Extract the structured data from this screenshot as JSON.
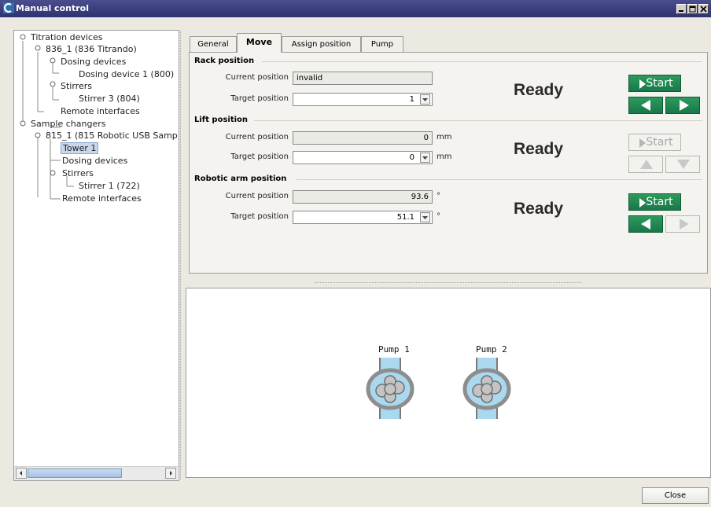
{
  "window": {
    "title": "Manual control",
    "icon": "app-logo-icon",
    "controls": [
      "minimize-icon",
      "maximize-icon",
      "close-icon"
    ]
  },
  "tree": {
    "nodes": [
      {
        "label": "Titration devices"
      },
      {
        "label": "836_1 (836 Titrando)"
      },
      {
        "label": "Dosing devices"
      },
      {
        "label": "Dosing device 1 (800)"
      },
      {
        "label": "Stirrers"
      },
      {
        "label": "Stirrer 3 (804)"
      },
      {
        "label": "Remote interfaces"
      },
      {
        "label": "Sample changers"
      },
      {
        "label": "815_1 (815 Robotic USB Samp"
      },
      {
        "label": "Tower 1",
        "selected": true
      },
      {
        "label": "Dosing devices"
      },
      {
        "label": "Stirrers"
      },
      {
        "label": "Stirrer 1 (722)"
      },
      {
        "label": "Remote interfaces"
      }
    ]
  },
  "tabs": [
    {
      "label": "General"
    },
    {
      "label": "Move",
      "active": true
    },
    {
      "label": "Assign position"
    },
    {
      "label": "Pump"
    }
  ],
  "move": {
    "rack": {
      "title": "Rack position",
      "current_label": "Current position",
      "current_value": "invalid",
      "target_label": "Target position",
      "target_value": "1",
      "status": "Ready",
      "start_label": "Start",
      "start_enabled": true
    },
    "lift": {
      "title": "Lift position",
      "current_label": "Current position",
      "current_value": "0",
      "current_unit": "mm",
      "target_label": "Target position",
      "target_value": "0",
      "target_unit": "mm",
      "status": "Ready",
      "start_label": "Start",
      "start_enabled": false
    },
    "arm": {
      "title": "Robotic arm position",
      "current_label": "Current position",
      "current_value": "93.6",
      "current_unit": "°",
      "target_label": "Target position",
      "target_value": "51.1",
      "target_unit": "°",
      "status": "Ready",
      "start_label": "Start",
      "start_enabled": true
    }
  },
  "pumps": [
    {
      "label": "Pump 1"
    },
    {
      "label": "Pump 2"
    }
  ],
  "footer": {
    "close_label": "Close"
  },
  "colors": {
    "titlebar": "#34387a",
    "button_green": "#1f8050",
    "pump_tube": "#a9d8ef",
    "pump_body": "#8d8d8d"
  }
}
